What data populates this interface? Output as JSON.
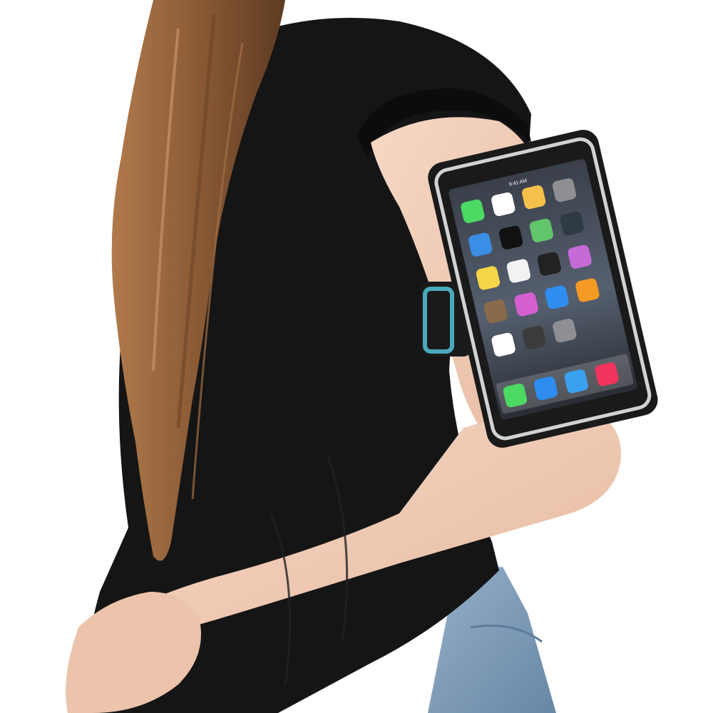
{
  "scene": {
    "background": "#ffffff",
    "shirt_color": "#151515",
    "hair_color": "#8a5a35",
    "skin_color": "#f1cdb8",
    "jeans_color": "#7d9ab7",
    "armband_color": "#1a1a1a",
    "armband_accent": "#4aa9bd",
    "armband_trim": "#cfd3d6"
  },
  "phone": {
    "status_time": "9:41 AM",
    "apps": [
      {
        "icon": "messages-icon",
        "color": "#4cd964"
      },
      {
        "icon": "calendar-icon",
        "color": "#ffffff"
      },
      {
        "icon": "photos-icon",
        "color": "#f7c04a"
      },
      {
        "icon": "camera-icon",
        "color": "#8e8e93"
      },
      {
        "icon": "weather-icon",
        "color": "#3a8ee6"
      },
      {
        "icon": "clock-icon",
        "color": "#111111"
      },
      {
        "icon": "maps-icon",
        "color": "#62c46b"
      },
      {
        "icon": "videos-icon",
        "color": "#2f3a45"
      },
      {
        "icon": "notes-icon",
        "color": "#f5d548"
      },
      {
        "icon": "reminders-icon",
        "color": "#f2f2f2"
      },
      {
        "icon": "stocks-icon",
        "color": "#222222"
      },
      {
        "icon": "game-center-icon",
        "color": "#c66ad8"
      },
      {
        "icon": "newsstand-icon",
        "color": "#8a6a4a"
      },
      {
        "icon": "itunes-store-icon",
        "color": "#d65fd0"
      },
      {
        "icon": "app-store-icon",
        "color": "#2f8cf0"
      },
      {
        "icon": "ibooks-icon",
        "color": "#f59a23"
      },
      {
        "icon": "health-icon",
        "color": "#ffffff"
      },
      {
        "icon": "passbook-icon",
        "color": "#3b3b3b"
      },
      {
        "icon": "settings-icon",
        "color": "#8e8e93"
      }
    ],
    "dock": [
      {
        "icon": "phone-icon",
        "color": "#4cd964"
      },
      {
        "icon": "mail-icon",
        "color": "#2f8cf0"
      },
      {
        "icon": "safari-icon",
        "color": "#3aa0f0"
      },
      {
        "icon": "music-icon",
        "color": "#f2345c"
      }
    ]
  }
}
